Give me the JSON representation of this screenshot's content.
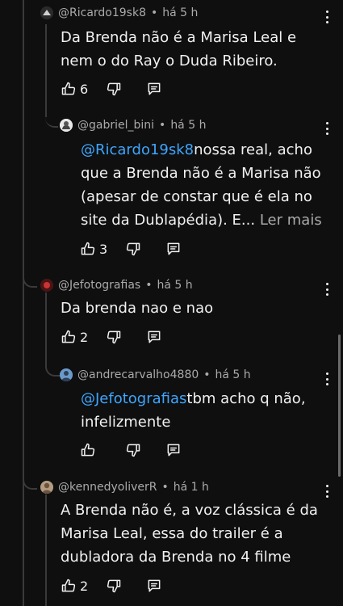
{
  "comments": [
    {
      "author": "@Ricardo19sk8",
      "time": "há 5 h",
      "mention": "",
      "lines": [
        "Da Brenda não é a Marisa Leal e",
        "nem o do Ray o Duda Ribeiro."
      ],
      "likes": "6"
    },
    {
      "author": "@gabriel_bini",
      "time": "há 5 h",
      "mention": "@Ricardo19sk8",
      "lines": [
        "nossa real, acho",
        "que a Brenda não é a Marisa não",
        "(apesar de constar que é ela no",
        "site da Dublapédia). E..."
      ],
      "read_more": "Ler mais",
      "likes": "3"
    },
    {
      "author": "@Jefotografias",
      "time": "há 5 h",
      "mention": "",
      "lines": [
        "Da brenda nao e nao"
      ],
      "likes": "2"
    },
    {
      "author": "@andrecarvalho4880",
      "time": "há 5 h",
      "mention": "@Jefotografias",
      "lines": [
        "tbm acho q não,",
        "infelizmente"
      ],
      "likes": ""
    },
    {
      "author": "@kennedyoliverR",
      "time": "há 1 h",
      "mention": "",
      "lines": [
        "A Brenda não é, a voz clássica é da",
        "Marisa Leal, essa do trailer é a",
        "dubladora da Brenda no 4 filme"
      ],
      "likes": "2"
    }
  ],
  "separator": "•",
  "icons": [
    "thumb-up-icon",
    "thumb-down-icon",
    "reply-icon",
    "more-vert-icon"
  ],
  "colors": {
    "background": "#0f0f0f",
    "text": "#f1f1f1",
    "meta": "#aaaaaa",
    "mention": "#3ea6ff",
    "thread": "#3a3a3a"
  }
}
